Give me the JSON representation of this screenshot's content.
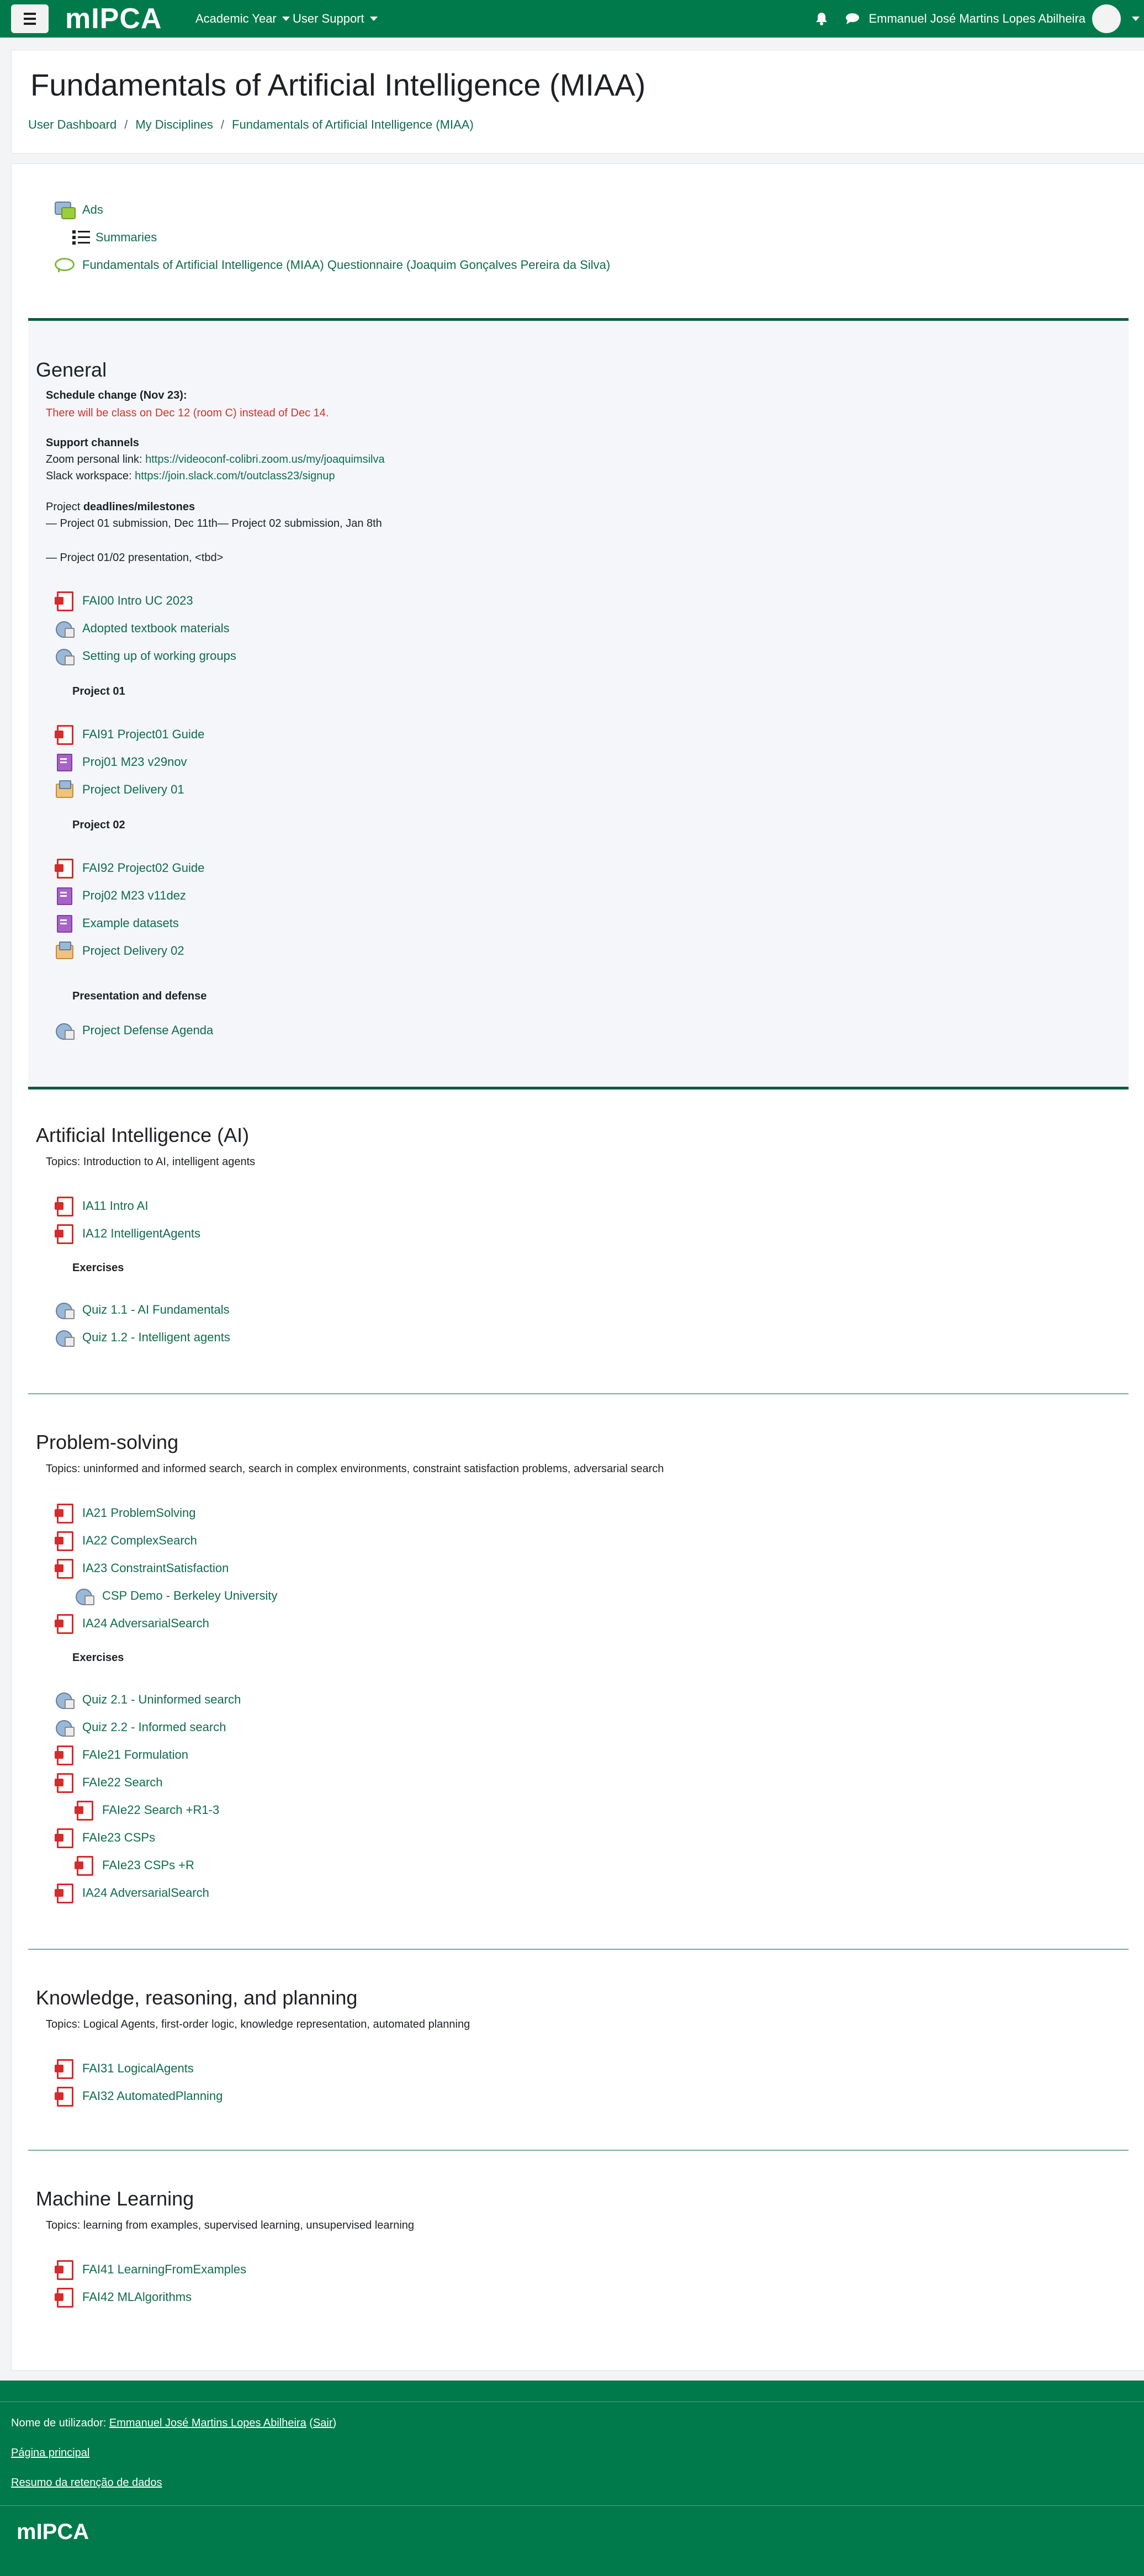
{
  "navbar": {
    "logo": "mIPCA",
    "menu": [
      "Academic Year",
      "User Support"
    ],
    "user_name": "Emmanuel José Martins Lopes Abilheira"
  },
  "header": {
    "title": "Fundamentals of Artificial Intelligence (MIAA)",
    "breadcrumb": [
      "User Dashboard",
      "My Disciplines",
      "Fundamentals of Artificial Intelligence (MIAA)"
    ],
    "separator": "/"
  },
  "top_activities": [
    {
      "label": "Ads",
      "icon": "forum-icon"
    },
    {
      "label": "Summaries",
      "icon": "list-icon"
    },
    {
      "label": "Fundamentals of Artificial Intelligence (MIAA) Questionnaire (Joaquim Gonçalves Pereira da Silva)",
      "icon": "feedback-icon"
    }
  ],
  "general": {
    "title": "General",
    "schedule_heading": "Schedule change (Nov 23):",
    "schedule_text": "There will be class on Dec 12 (room C) instead of Dec 14.",
    "support_heading": "Support channels",
    "zoom_prefix": "Zoom personal link: ",
    "zoom_link": "https://videoconf-colibri.zoom.us/my/joaquimsilva",
    "slack_prefix": "Slack workspace: ",
    "slack_link": "https://join.slack.com/t/outclass23/signup",
    "project_prefix": "Project ",
    "project_bold": "deadlines/milestones",
    "milestones_line1": "— Project 01 submission, Dec 11th— Project 02 submission, Jan 8th",
    "milestones_line2": "— Project 01/02 presentation, <tbd>",
    "items": [
      "FAI00 Intro UC 2023",
      "Adopted textbook materials",
      "Setting up of working groups"
    ],
    "project01_label": "Project 01",
    "project01_items": [
      "FAI91 Project01 Guide",
      "Proj01 M23 v29nov",
      "Project Delivery 01"
    ],
    "project02_label": "Project 02",
    "project02_items": [
      "FAI92 Project02 Guide",
      "Proj02 M23 v11dez",
      "Example datasets",
      "Project Delivery 02"
    ],
    "defense_label": "Presentation and defense",
    "defense_items": [
      "Project Defense Agenda"
    ]
  },
  "ai": {
    "title": "Artificial Intelligence (AI)",
    "topics": "Topics:  Introduction to AI, intelligent agents",
    "items": [
      "IA11 Intro AI",
      "IA12 IntelligentAgents"
    ],
    "exercises_label": "Exercises",
    "exercises": [
      "Quiz 1.1 - AI Fundamentals",
      "Quiz 1.2 - Intelligent agents"
    ]
  },
  "problem": {
    "title": "Problem-solving",
    "topics": "Topics: uninformed and informed search, search in complex environments, constraint satisfaction problems, adversarial search",
    "items": [
      "IA21 ProblemSolving",
      "IA22 ComplexSearch",
      "IA23 ConstraintSatisfaction",
      "CSP Demo - Berkeley University",
      "IA24 AdversarialSearch"
    ],
    "exercises_label": "Exercises",
    "exercises": [
      "Quiz 2.1 - Uninformed search",
      "Quiz 2.2 - Informed search",
      "FAIe21 Formulation",
      "FAIe22 Search",
      "FAIe22 Search +R1-3",
      "FAIe23 CSPs",
      "FAIe23 CSPs +R",
      "IA24 AdversarialSearch"
    ]
  },
  "knowledge": {
    "title": "Knowledge, reasoning, and planning",
    "topics": "Topics: Logical Agents, first-order logic, knowledge representation, automated planning",
    "items": [
      "FAI31 LogicalAgents",
      "FAI32 AutomatedPlanning"
    ]
  },
  "ml": {
    "title": "Machine Learning",
    "topics": "Topics: learning from examples, supervised learning, unsupervised learning",
    "items": [
      "FAI41 LearningFromExamples",
      "FAI42 MLAlgorithms"
    ]
  },
  "footer": {
    "user_prefix": "Nome de utilizador: ",
    "user_name": "Emmanuel José Martins Lopes Abilheira",
    "logout": "Sair",
    "home": "Página principal",
    "data_retention": "Resumo da retenção de dados",
    "logo": "mIPCA"
  }
}
